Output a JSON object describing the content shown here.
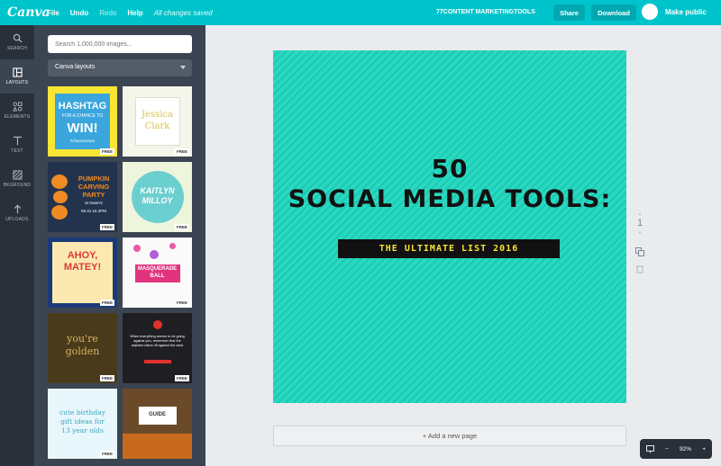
{
  "app": {
    "logo": "Canva"
  },
  "menu": {
    "file": "File",
    "undo": "Undo",
    "redo": "Redo",
    "help": "Help",
    "status": "All changes saved"
  },
  "document": {
    "title": "77CONTENT MARKETINGTOOLS"
  },
  "actions": {
    "share": "Share",
    "download": "Download",
    "make_public": "Make public"
  },
  "rail": [
    {
      "label": "SEARCH",
      "icon": "search-icon"
    },
    {
      "label": "LAYOUTS",
      "icon": "layouts-icon"
    },
    {
      "label": "ELEMENTS",
      "icon": "elements-icon"
    },
    {
      "label": "TEXT",
      "icon": "text-icon"
    },
    {
      "label": "BKGROUND",
      "icon": "background-icon"
    },
    {
      "label": "UPLOADS",
      "icon": "uploads-icon"
    }
  ],
  "panel": {
    "search_placeholder": "Search 1,000,000 images...",
    "select_value": "Canva layouts",
    "free_label": "FREE",
    "templates": {
      "t1": {
        "l1": "HASHTAG",
        "l2": "FOR A CHANCE TO",
        "l3": "WIN!",
        "l4": "#chancetowin"
      },
      "t2": {
        "l1": "Jessica",
        "l2": "Clark"
      },
      "t3": {
        "l1": "PUMPKIN",
        "l2": "CARVING",
        "l3": "PARTY",
        "l4": "at Owen's",
        "l5": "05.31.15 2PM"
      },
      "t4": {
        "l1": "KAITLYN",
        "l2": "MILLOY"
      },
      "t5": {
        "l1": "AHOY,",
        "l2": "MATEY!"
      },
      "t6": {
        "l1": "MASQUERADE",
        "l2": "BALL"
      },
      "t7": {
        "l1": "you're",
        "l2": "golden"
      },
      "t8": {
        "l1": "When everything seems to be going against you, remember that the airplane takes off against the wind"
      },
      "t9": {
        "l1": "cute birthday",
        "l2": "gift ideas for",
        "l3": "13 year olds"
      },
      "t10": {
        "l1": "GUIDE"
      }
    }
  },
  "canvas": {
    "line1": "50",
    "line2": "SOCIAL MEDIA TOOLS:",
    "subtitle": "THE ULTIMATE LIST 2016",
    "page_number": "1",
    "add_page": "+ Add a new page"
  },
  "zoom": {
    "minus": "−",
    "level": "92%",
    "plus": "+"
  },
  "colors": {
    "brand": "#00c4cc",
    "canvas_bg": "#2ad8c0",
    "subtitle_text": "#f6e23a"
  }
}
